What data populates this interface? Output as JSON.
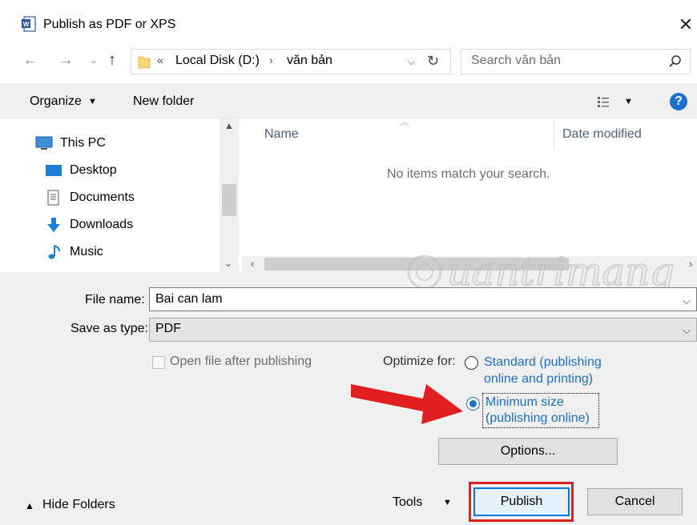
{
  "window": {
    "title": "Publish as PDF or XPS",
    "close_glyph": "✕"
  },
  "address": {
    "overflow": "«",
    "crumbs": [
      "Local Disk (D:)",
      "văn bản"
    ],
    "separator": "›"
  },
  "search": {
    "placeholder": "Search văn bản"
  },
  "toolbar": {
    "organize": "Organize",
    "new_folder": "New folder",
    "help": "?"
  },
  "nav_pane": {
    "items": [
      {
        "label": "This PC",
        "icon": "pc-icon"
      },
      {
        "label": "Desktop",
        "icon": "desktop-icon"
      },
      {
        "label": "Documents",
        "icon": "documents-icon"
      },
      {
        "label": "Downloads",
        "icon": "downloads-icon"
      },
      {
        "label": "Music",
        "icon": "music-icon"
      }
    ]
  },
  "file_list": {
    "columns": [
      "Name",
      "Date modified"
    ],
    "empty_message": "No items match your search."
  },
  "form": {
    "file_name_label": "File name:",
    "file_name_value": "Bai can lam",
    "save_as_type_label": "Save as type:",
    "save_as_type_value": "PDF",
    "open_after_label": "Open file after publishing",
    "open_after_checked": false,
    "optimize_label": "Optimize for:",
    "optimize_options": [
      {
        "line1": "Standard (publishing",
        "line2": "online and printing)",
        "selected": false
      },
      {
        "line1": "Minimum size",
        "line2": "(publishing online)",
        "selected": true
      }
    ]
  },
  "buttons": {
    "options": "Options...",
    "tools": "Tools",
    "publish": "Publish",
    "cancel": "Cancel",
    "hide_folders": "Hide Folders"
  },
  "colors": {
    "accent": "#1a73c9",
    "annotation_red": "#e02020",
    "dialog_bg": "#f0f0f0"
  }
}
